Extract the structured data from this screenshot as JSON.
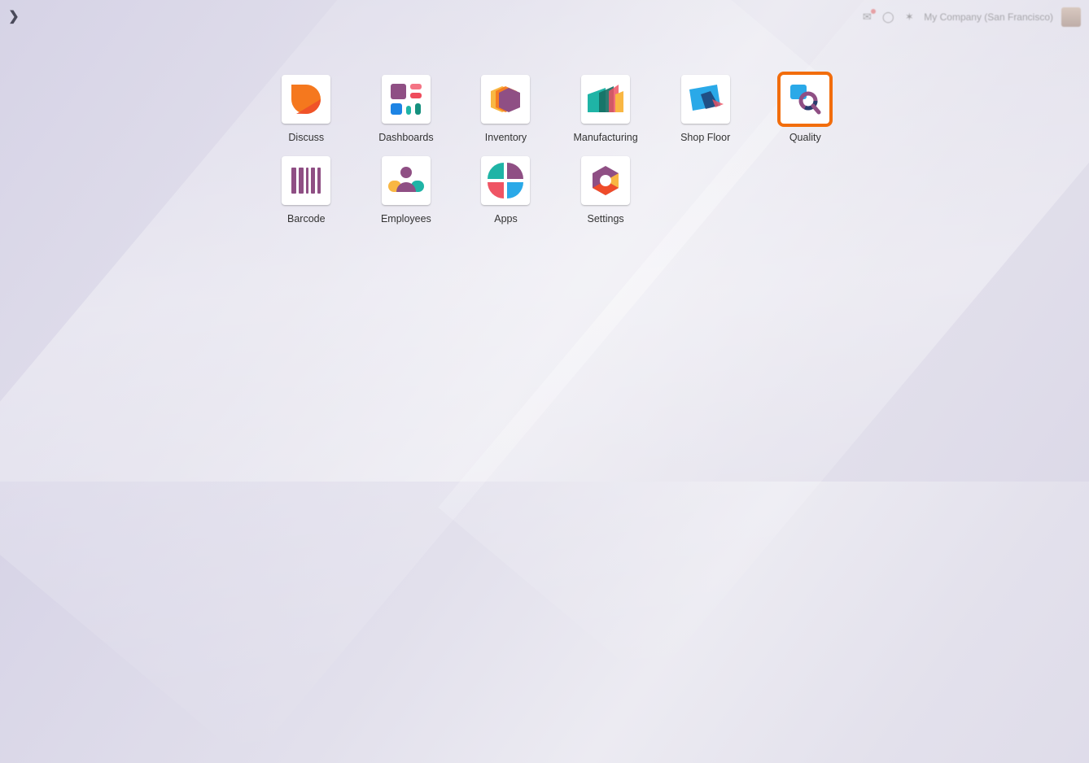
{
  "topbar": {
    "company_name": "My Company (San Francisco)"
  },
  "apps": [
    {
      "label": "Discuss",
      "icon": "discuss-icon"
    },
    {
      "label": "Dashboards",
      "icon": "dashboards-icon"
    },
    {
      "label": "Inventory",
      "icon": "inventory-icon"
    },
    {
      "label": "Manufacturing",
      "icon": "manufacturing-icon"
    },
    {
      "label": "Shop Floor",
      "icon": "shop-floor-icon"
    },
    {
      "label": "Quality",
      "icon": "quality-icon",
      "selected": true
    },
    {
      "label": "Barcode",
      "icon": "barcode-icon"
    },
    {
      "label": "Employees",
      "icon": "employees-icon"
    },
    {
      "label": "Apps",
      "icon": "apps-icon"
    },
    {
      "label": "Settings",
      "icon": "settings-icon"
    }
  ],
  "colors": {
    "selection_outline": "#f26d0c",
    "purple": "#8f4f84",
    "orange": "#f5781e",
    "teal": "#1fb4a6",
    "blue": "#2aa9e8",
    "red": "#ef5464",
    "yellow": "#f9b743"
  }
}
